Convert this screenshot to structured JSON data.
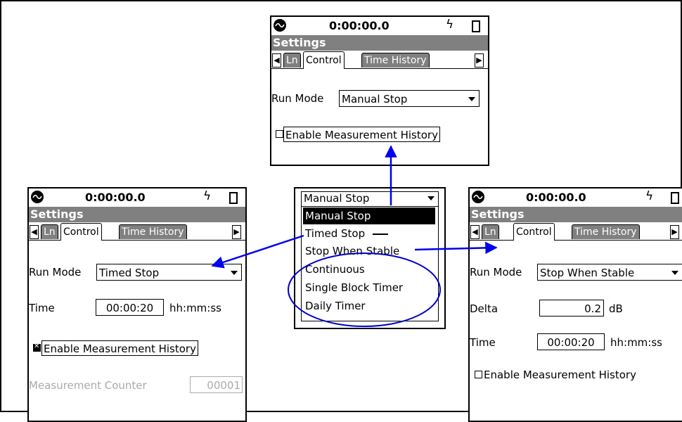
{
  "status_time": "0:00:00.0",
  "title": "Settings",
  "tabs": {
    "ln": "Ln",
    "control": "Control",
    "time_history": "Time History"
  },
  "run_mode_label": "Run Mode",
  "enable_history_label": "Enable Measurement History",
  "top_screen": {
    "run_mode": "Manual Stop",
    "history_checked": false
  },
  "left_screen": {
    "run_mode": "Timed Stop",
    "time_label": "Time",
    "time_value": "00:00:20",
    "time_unit": "hh:mm:ss",
    "history_checked": true,
    "counter_label": "Measurement Counter",
    "counter_value": "00001"
  },
  "right_screen": {
    "run_mode": "Stop When Stable",
    "delta_label": "Delta",
    "delta_value": "0.2",
    "delta_unit": "dB",
    "time_label": "Time",
    "time_value": "00:00:20",
    "time_unit": "hh:mm:ss",
    "history_checked": false
  },
  "dropdown": {
    "current": "Manual Stop",
    "options": [
      "Manual Stop",
      "Timed Stop",
      "Stop When Stable",
      "Continuous",
      "Single Block Timer",
      "Daily Timer"
    ],
    "selected_index": 0
  },
  "colors": {
    "arrow": "#0000ee",
    "highlight_circle": "#0000cc",
    "titlebar": "#808080"
  }
}
